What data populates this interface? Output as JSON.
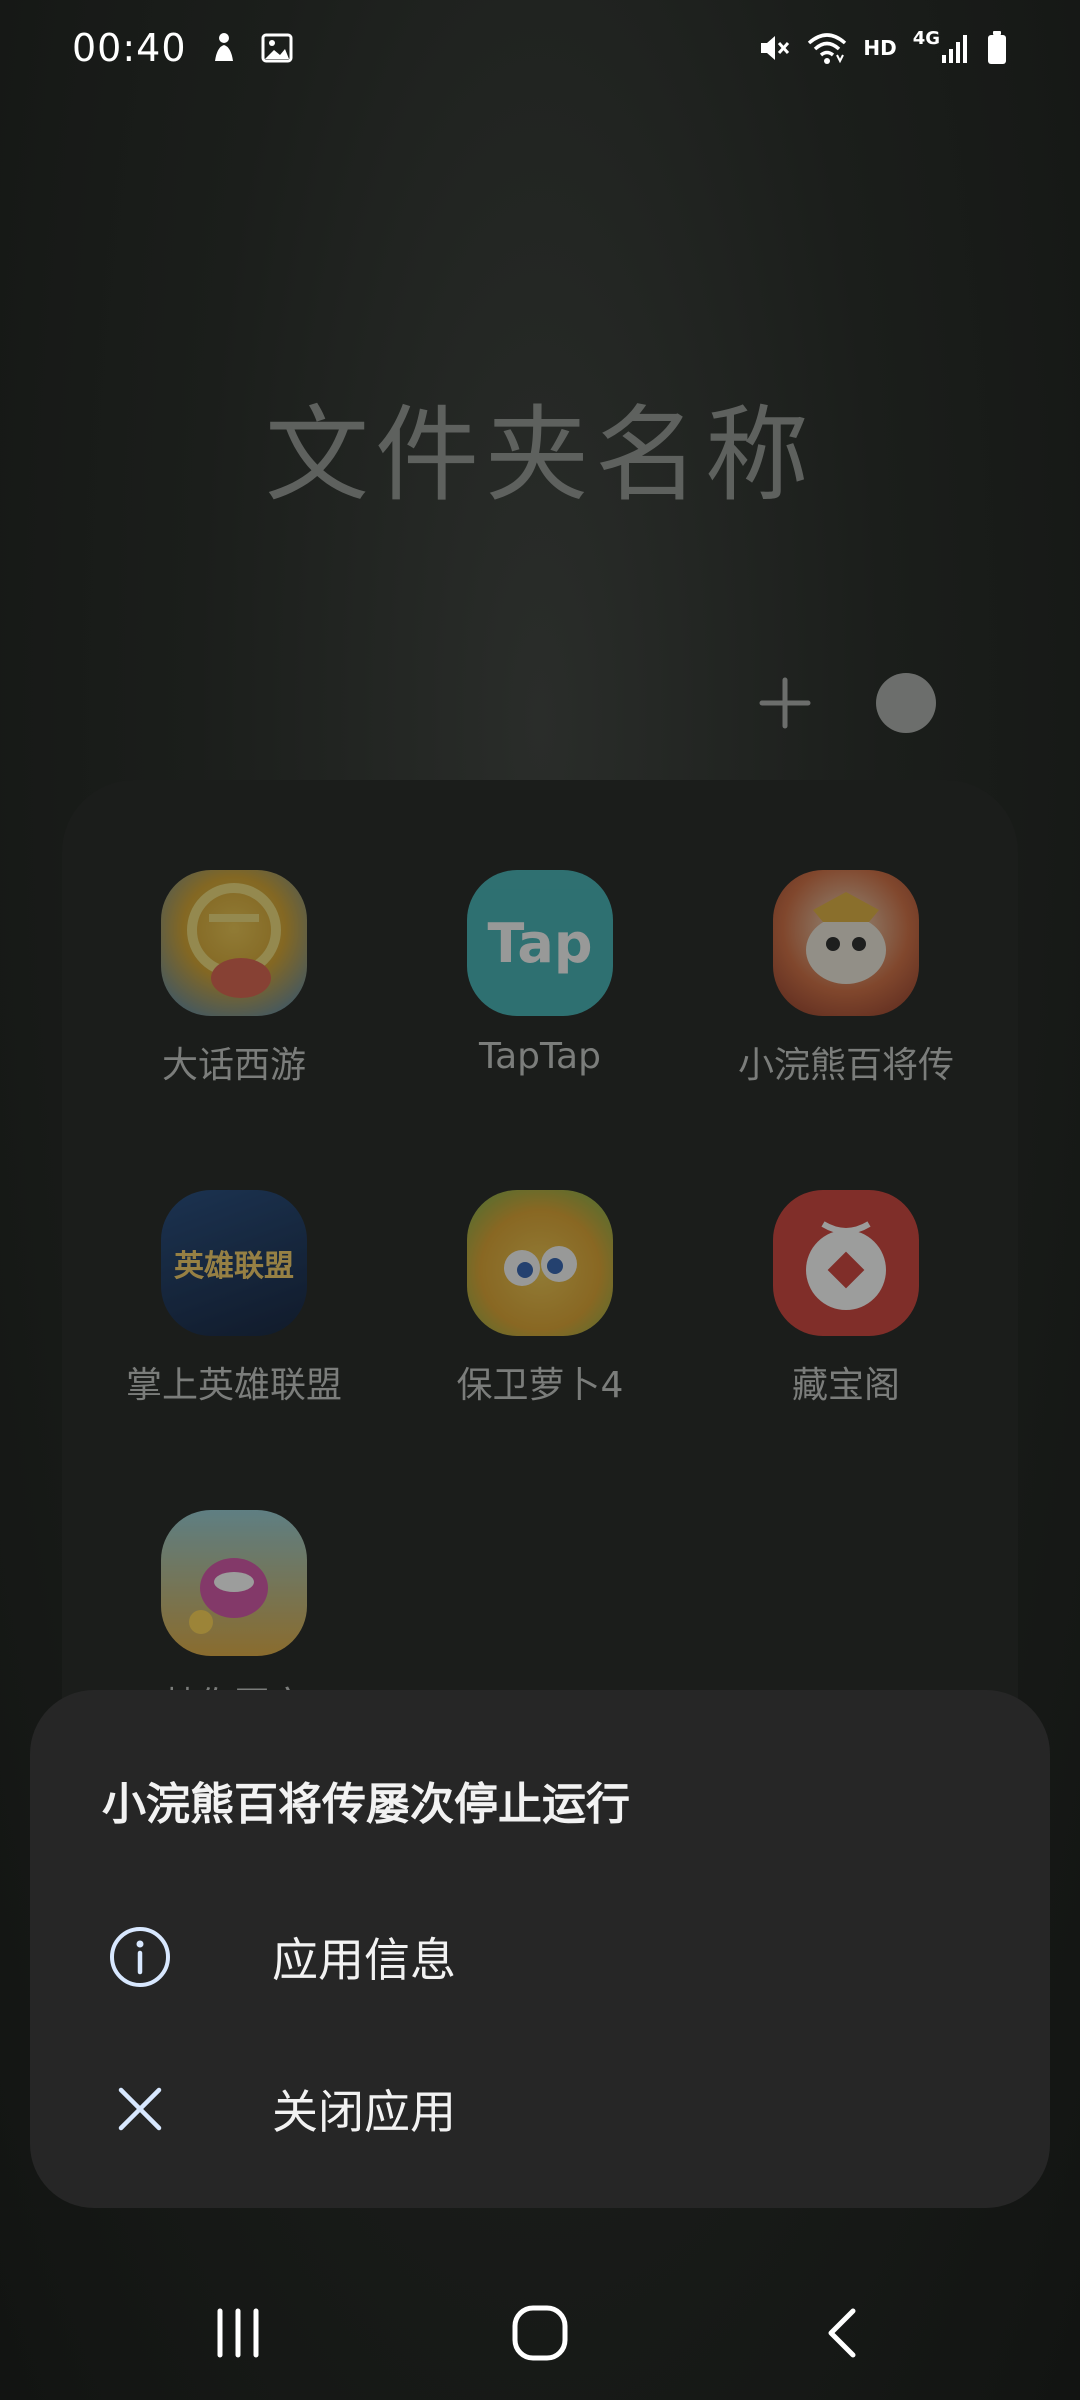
{
  "status_bar": {
    "time": "00:40",
    "left_icons": [
      "figure-notification-icon",
      "gallery-notification-icon"
    ],
    "right_icons": [
      "mute-icon",
      "wifi-icon",
      "hd-icon",
      "signal-icon",
      "battery-icon"
    ],
    "hd_label": "HD",
    "network_label": "4G"
  },
  "folder": {
    "name_placeholder": "文件夹名称",
    "add_icon": "plus-icon",
    "color_dot_color": "#6c6e6c"
  },
  "apps": [
    {
      "label": "大话西游",
      "icon": "dahuaxiyou-app-icon",
      "color": "#d9a52a"
    },
    {
      "label": "TapTap",
      "icon": "taptap-app-icon",
      "color": "#3fb5b8",
      "glyph": "Tap"
    },
    {
      "label": "小浣熊百将传",
      "icon": "xiaohuanxiong-app-icon",
      "color": "#c85a34"
    },
    {
      "label": "掌上英雄联盟",
      "icon": "league-of-legends-app-icon",
      "color": "#1d3a63",
      "glyph": "英雄联盟"
    },
    {
      "label": "保卫萝卜4",
      "icon": "carrot-defense-app-icon",
      "color": "#d7b21d"
    },
    {
      "label": "藏宝阁",
      "icon": "cangbaoge-app-icon",
      "color": "#c33a33"
    },
    {
      "label": "梦你国家",
      "icon": "monster-app-icon",
      "color": "#6fa6b0"
    }
  ],
  "dialog": {
    "title": "小浣熊百将传屡次停止运行",
    "items": [
      {
        "label": "应用信息",
        "icon": "info-icon"
      },
      {
        "label": "关闭应用",
        "icon": "close-icon"
      }
    ]
  },
  "nav_bar": {
    "buttons": [
      "recent-apps-icon",
      "home-icon",
      "back-icon"
    ]
  }
}
